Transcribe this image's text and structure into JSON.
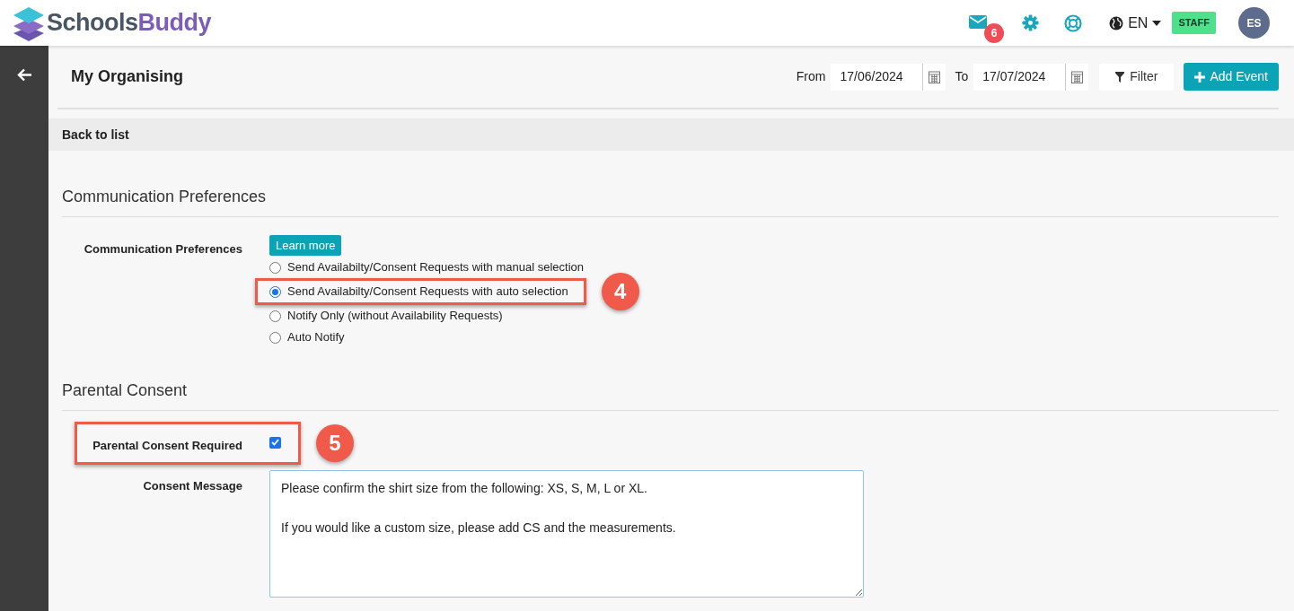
{
  "header": {
    "logo_part1": "Schools",
    "logo_part2": "Buddy",
    "mail_count": "6",
    "language": "EN",
    "role_badge": "STAFF",
    "avatar_initials": "ES"
  },
  "toolbar": {
    "title": "My Organising",
    "from_label": "From",
    "from_date": "17/06/2024",
    "to_label": "To",
    "to_date": "17/07/2024",
    "filter_button": "Filter",
    "add_button": "Add Event"
  },
  "back_link": "Back to list",
  "communication": {
    "heading": "Communication Preferences",
    "label": "Communication Preferences",
    "learn_more": "Learn more",
    "options": [
      {
        "label": "Send Availabilty/Consent Requests with manual selection",
        "selected": false
      },
      {
        "label": "Send Availabilty/Consent Requests with auto selection",
        "selected": true,
        "callout": "4"
      },
      {
        "label": "Notify Only (without Availability Requests)",
        "selected": false
      },
      {
        "label": "Auto Notify",
        "selected": false
      }
    ]
  },
  "consent": {
    "heading": "Parental Consent",
    "checkbox_label": "Parental Consent Required",
    "checked": true,
    "callout": "5",
    "message_label": "Consent Message",
    "message": "Please confirm the shirt size from the following: XS, S, M, L or XL.\n\nIf you would like a custom size, please add CS and the measurements."
  }
}
